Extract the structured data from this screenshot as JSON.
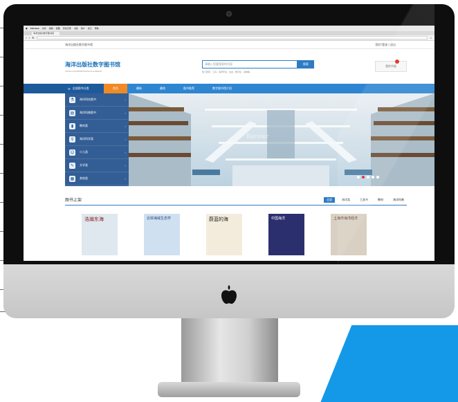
{
  "os_menubar": {
    "app": "Chrome",
    "items": [
      "文件",
      "编辑",
      "视图",
      "历史记录",
      "书签",
      "用户",
      "窗口",
      "帮助"
    ]
  },
  "browser": {
    "tab_title": "海洋出版社数字图书馆",
    "address": ""
  },
  "site": {
    "top_strip": {
      "left": "海洋出版社数字图书馆",
      "right": "您好!登录 | 退出"
    },
    "logo": {
      "title": "海洋出版社数字图书馆",
      "subtitle": "WWW.OCEANPRESSDIGITALLIBRARY"
    },
    "search": {
      "placeholder": "请输入您要搜索的内容",
      "button": "搜索",
      "hot": "热门搜索：工具、海洋环境、生态、数字化、读物等"
    },
    "cart": {
      "label": "我的书架",
      "count": "0"
    },
    "nav": {
      "category_label": "全部图书分类",
      "items": [
        {
          "label": "首页",
          "active": true
        },
        {
          "label": "最新",
          "active": false
        },
        {
          "label": "最热",
          "active": false
        },
        {
          "label": "图书推荐",
          "active": false
        },
        {
          "label": "数字图书馆介绍",
          "active": false
        }
      ]
    },
    "categories": [
      {
        "label": "海洋科技图书",
        "icon": "flask-icon"
      },
      {
        "label": "海洋科普图书",
        "icon": "books-icon"
      },
      {
        "label": "教材类",
        "icon": "book-icon"
      },
      {
        "label": "海洋科学类",
        "icon": "microscope-icon"
      },
      {
        "label": "少儿类",
        "icon": "child-icon"
      },
      {
        "label": "文学类",
        "icon": "pen-icon"
      },
      {
        "label": "其他类",
        "icon": "grid-icon"
      }
    ],
    "banner_text": "Banner",
    "section": {
      "title": "图书上架",
      "filters": [
        {
          "label": "全部",
          "active": true
        },
        {
          "label": "海洋类",
          "active": false
        },
        {
          "label": "工具书",
          "active": false
        },
        {
          "label": "教材",
          "active": false
        },
        {
          "label": "海洋科普",
          "active": false
        }
      ]
    },
    "books": [
      {
        "title": "浩瀚东海",
        "cover_bg": "#dfe7ef",
        "fg": "#8b1a1a"
      },
      {
        "title": "近岸海域生态学",
        "cover_bg": "#cfe0f0",
        "fg": "#2a4a7a"
      },
      {
        "title": "蔚蓝的海",
        "cover_bg": "#f3ecdc",
        "fg": "#222222"
      },
      {
        "title": "中国海洋",
        "cover_bg": "#2c2f6e",
        "fg": "#ffffff"
      },
      {
        "title": "上海市海洋经济",
        "cover_bg": "#d9cfc2",
        "fg": "#5a3a2a"
      }
    ]
  },
  "colors": {
    "primary": "#2e7bc4",
    "nav_bg": "#2e86d2",
    "active_tab": "#f08a24",
    "cat_menu": "#22508c",
    "accent_red": "#e2221d",
    "brand_blue": "#1499e8"
  }
}
